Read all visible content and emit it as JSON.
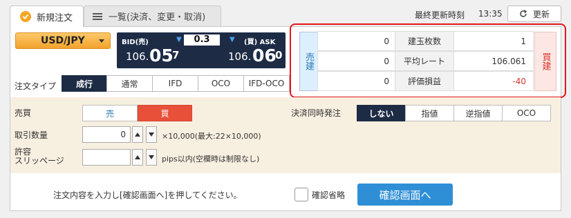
{
  "tabs": [
    {
      "label": "新規注文",
      "icon": "check-icon",
      "active": true
    },
    {
      "label": "一覧(決済、変更・取消)",
      "icon": "list-icon",
      "active": false
    }
  ],
  "header": {
    "last_updated_label": "最終更新時刻",
    "last_updated_time": "13:35",
    "refresh_label": "更新",
    "refresh_icon": "refresh-icon"
  },
  "pair": {
    "selected": "USD/JPY"
  },
  "quote": {
    "bid_label": "BID(売)",
    "ask_label": "(買) ASK",
    "spread": "0.3",
    "bid": {
      "head": "106.",
      "big": "05",
      "tail": "7"
    },
    "ask": {
      "head": "106.",
      "big": "06",
      "tail": "0"
    },
    "arrow_icon": "down-arrow-icon"
  },
  "order_type": {
    "label": "注文タイプ",
    "options": [
      "成行",
      "通常",
      "IFD",
      "OCO",
      "IFD-OCO"
    ],
    "selected": "成行"
  },
  "positions": {
    "sell_label": "売建",
    "buy_label": "買建",
    "rows": [
      {
        "sell": "0",
        "label": "建玉枚数",
        "buy": "1"
      },
      {
        "sell": "0",
        "label": "平均レート",
        "buy": "106.061"
      },
      {
        "sell": "0",
        "label": "評価損益",
        "buy": "-40"
      }
    ],
    "loss_color": "#d9362b"
  },
  "side": {
    "label": "売買",
    "sell": "売",
    "buy": "買",
    "selected": "買"
  },
  "quantity": {
    "label": "取引数量",
    "value": "0",
    "hint": "×10,000(最大:22×10,000)"
  },
  "slippage": {
    "label1": "許容",
    "label2": "スリッページ",
    "value": "",
    "hint": "pips以内(空欄時は制限なし)"
  },
  "settlement": {
    "label": "決済同時発注",
    "options": [
      "しない",
      "指値",
      "逆指値",
      "OCO"
    ],
    "selected": "しない"
  },
  "footer": {
    "message": "注文内容を入力し[確認画面へ]を押してください。",
    "skip_label": "確認省略",
    "confirm_label": "確認画面へ"
  },
  "colors": {
    "accent_orange": "#f2a22c",
    "navy": "#1d2b45",
    "buy_red": "#e8503a",
    "confirm_blue": "#2f8fd6",
    "highlight_border": "#e3141b"
  }
}
